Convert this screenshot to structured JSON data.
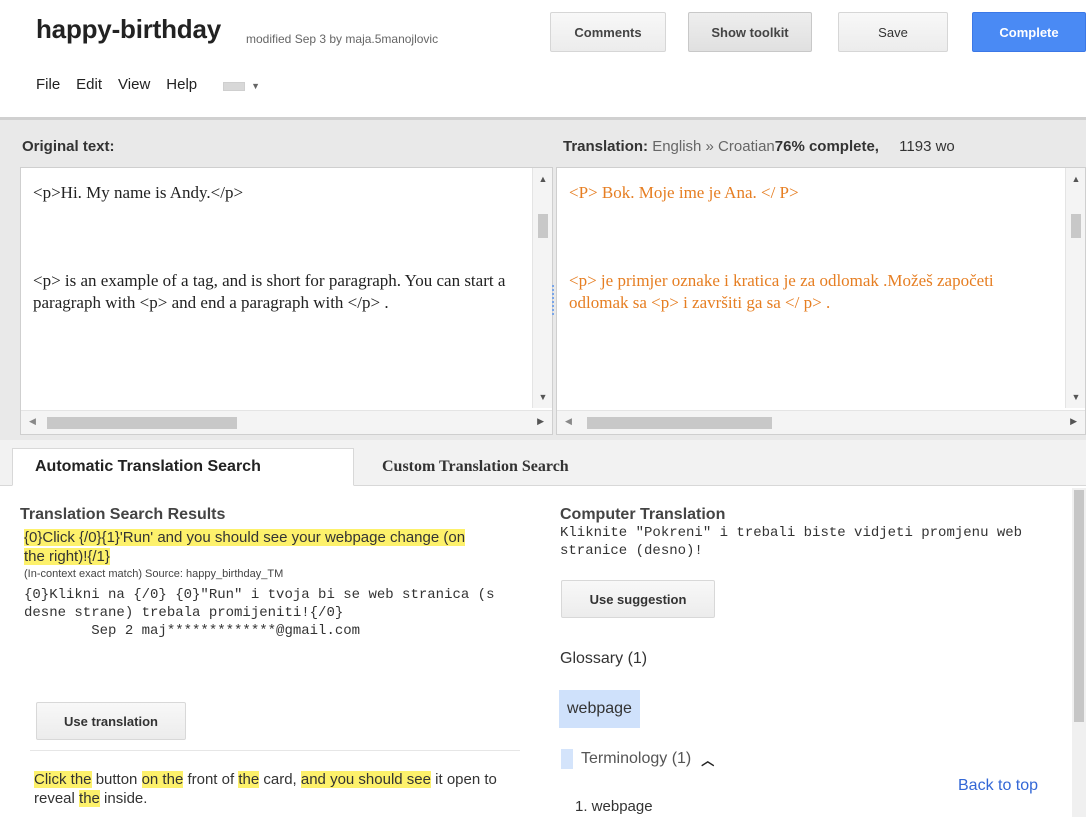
{
  "header": {
    "title": "happy-birthday",
    "meta": "modified Sep 3 by maja.5manojlovic",
    "buttons": {
      "comments": "Comments",
      "show_toolkit": "Show toolkit",
      "save": "Save",
      "complete": "Complete"
    },
    "accent_color": "#4a8af4"
  },
  "menu": {
    "items": [
      "File",
      "Edit",
      "View",
      "Help"
    ]
  },
  "editor": {
    "original_label": "Original text:",
    "translation_label": "Translation:",
    "translation_lang": "English » Croatian",
    "translation_percent": "76% complete,",
    "translation_words": "1193 wo",
    "original_paragraphs": [
      "<p>Hi. My name is Andy.</p>",
      "<p> is an example of a tag, and is short for paragraph. You can start a paragraph with <p> and end a paragraph with </p> ."
    ],
    "translation_paragraphs": [
      "<P> Bok. Moje ime je Ana. </ P>",
      "<p> je primjer oznake i kratica je za   odlomak .Možeš započeti   odlomak sa <p> i završiti ga sa </ p> ."
    ],
    "translation_color": "#e67e22"
  },
  "tabs": {
    "automatic": "Automatic Translation Search",
    "custom": "Custom Translation Search"
  },
  "results": {
    "title": "Translation Search Results",
    "source_parts": [
      {
        "text": "{0}Click {/0}{1}'Run' and you should see your webpage change (on the right)!{/1}",
        "hl": true
      }
    ],
    "match_info": "(In-context exact match) Source: happy_birthday_TM",
    "target": "{0}Klikni na {/0} {0}\"Run\" i tvoja bi se web stranica (s desne strane) trebala promijeniti!{/0}",
    "by_line": "        Sep 2 maj*************@gmail.com",
    "use_translation": "Use translation",
    "next_source": [
      {
        "text": "Click the",
        "hl": true
      },
      {
        "text": " button ",
        "hl": false
      },
      {
        "text": "on the",
        "hl": true
      },
      {
        "text": " front of ",
        "hl": false
      },
      {
        "text": "the",
        "hl": true
      },
      {
        "text": " card, ",
        "hl": false
      },
      {
        "text": "and you should see",
        "hl": true
      },
      {
        "text": " it open to reveal ",
        "hl": false
      },
      {
        "text": "the",
        "hl": true
      },
      {
        "text": " inside.",
        "hl": false
      }
    ]
  },
  "computer": {
    "title": "Computer Translation",
    "text": "Kliknite \"Pokreni\" i trebali biste vidjeti promjenu web stranice (desno)!",
    "use_suggestion": "Use suggestion",
    "glossary_title": "Glossary (1)",
    "glossary_term": "webpage",
    "terminology": "Terminology (1)",
    "term_item": "1. webpage",
    "back_to_top": "Back to top"
  }
}
